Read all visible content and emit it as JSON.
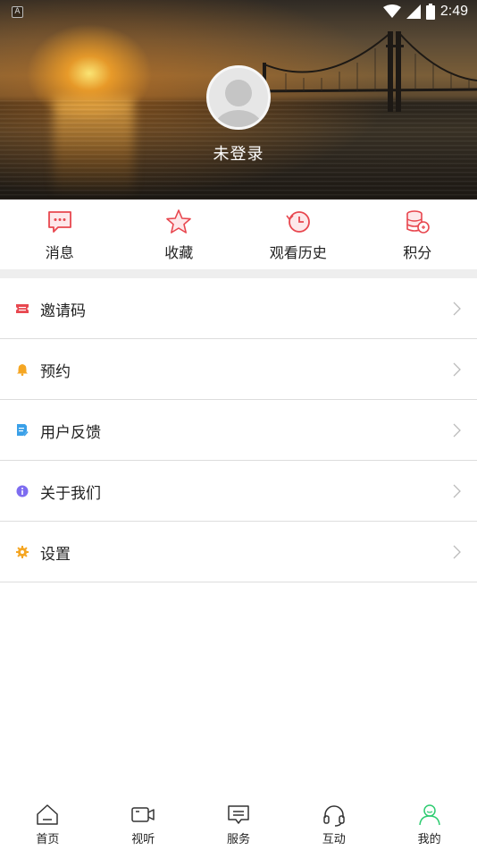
{
  "status_bar": {
    "notification_letter": "A",
    "time": "2:49",
    "icons": [
      "wifi-icon",
      "signal-icon",
      "battery-icon"
    ]
  },
  "profile": {
    "avatar": "default-avatar-icon",
    "login_status": "未登录"
  },
  "quick_actions": [
    {
      "label": "消息",
      "icon": "message-icon"
    },
    {
      "label": "收藏",
      "icon": "star-icon"
    },
    {
      "label": "观看历史",
      "icon": "history-icon"
    },
    {
      "label": "积分",
      "icon": "coins-icon"
    }
  ],
  "menu": [
    {
      "label": "邀请码",
      "icon": "ticket-icon",
      "icon_color": "#e8474f"
    },
    {
      "label": "预约",
      "icon": "bell-icon",
      "icon_color": "#f5a623"
    },
    {
      "label": "用户反馈",
      "icon": "feedback-icon",
      "icon_color": "#3aa0e8"
    },
    {
      "label": "关于我们",
      "icon": "info-icon",
      "icon_color": "#7d6cf0"
    },
    {
      "label": "设置",
      "icon": "gear-icon",
      "icon_color": "#f5a623"
    }
  ],
  "bottom_nav": [
    {
      "label": "首页",
      "icon": "home-icon",
      "active": false
    },
    {
      "label": "视听",
      "icon": "video-icon",
      "active": false
    },
    {
      "label": "服务",
      "icon": "service-icon",
      "active": false
    },
    {
      "label": "互动",
      "icon": "headset-icon",
      "active": false
    },
    {
      "label": "我的",
      "icon": "profile-icon",
      "active": true
    }
  ],
  "colors": {
    "accent_red": "#e8474f",
    "active_nav": "#2ecc71",
    "icon_gray": "#333333"
  }
}
